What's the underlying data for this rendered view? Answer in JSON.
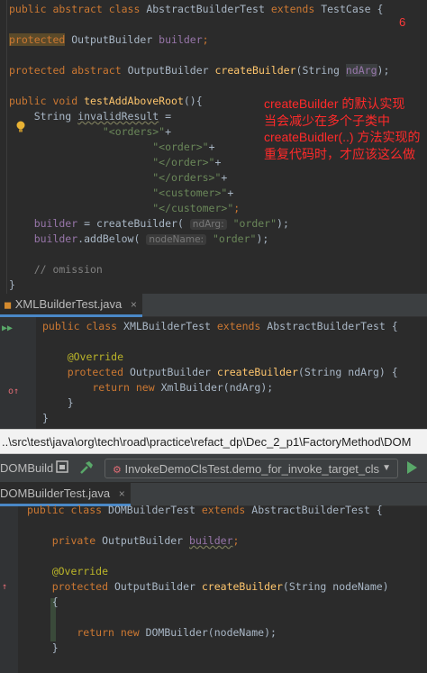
{
  "panel1": {
    "lines": [
      [
        [
          "kw",
          "public abstract class "
        ],
        [
          "cls",
          "AbstractBuilderTest "
        ],
        [
          "kw",
          "extends "
        ],
        [
          "cls",
          "TestCase {"
        ]
      ],
      [],
      [
        [
          "prot",
          "protected"
        ],
        [
          "cls",
          " OutputBuilder "
        ],
        [
          "field",
          "builder"
        ],
        [
          "kw",
          ";"
        ]
      ],
      [],
      [
        [
          "kw",
          "protected abstract "
        ],
        [
          "cls",
          "OutputBuilder "
        ],
        [
          "fn",
          "createBuilder"
        ],
        [
          "cls",
          "(String "
        ],
        [
          "param",
          "ndArg"
        ],
        [
          "cls",
          ");"
        ]
      ],
      [],
      [
        [
          "kw",
          "public void "
        ],
        [
          "fn",
          "testAddAboveRoot"
        ],
        [
          "cls",
          "(){"
        ]
      ],
      [
        [
          "cls",
          "    String "
        ],
        [
          "warn",
          "invalidResult"
        ],
        [
          "cls",
          " ="
        ]
      ],
      [
        [
          "str",
          "               \"<orders>\""
        ],
        [
          "cls",
          "+"
        ]
      ],
      [
        [
          "str",
          "                       \"<order>\""
        ],
        [
          "cls",
          "+"
        ]
      ],
      [
        [
          "str",
          "                       \"</order>\""
        ],
        [
          "cls",
          "+"
        ]
      ],
      [
        [
          "str",
          "                       \"</orders>\""
        ],
        [
          "cls",
          "+"
        ]
      ],
      [
        [
          "str",
          "                       \"<customer>\""
        ],
        [
          "cls",
          "+"
        ]
      ],
      [
        [
          "str",
          "                       \"</customer>\""
        ],
        [
          "kw",
          ";"
        ]
      ],
      [
        [
          "field",
          "    builder"
        ],
        [
          "cls",
          " = createBuilder( "
        ],
        [
          "hint",
          "ndArg:"
        ],
        [
          "str",
          " \"order\""
        ],
        [
          "cls",
          ");"
        ]
      ],
      [
        [
          "field",
          "    builder"
        ],
        [
          "cls",
          ".addBelow( "
        ],
        [
          "hint",
          "nodeName:"
        ],
        [
          "str",
          " \"order\""
        ],
        [
          "cls",
          ");"
        ]
      ],
      [],
      [
        [
          "cmt",
          "    // omission"
        ]
      ],
      [
        [
          "cls",
          "}"
        ]
      ]
    ],
    "annotation_lines": [
      "createBuilder 的默认实现",
      "当会减少在多个子类中",
      "createBuidler(..) 方法实现的",
      "重复代码时，才应该这么做"
    ],
    "marker": "6"
  },
  "panel2": {
    "tab_label": "XMLBuilderTest.java",
    "tab_close": "×",
    "lines": [
      [
        [
          "kw",
          "public class "
        ],
        [
          "cls",
          "XMLBuilderTest "
        ],
        [
          "kw",
          "extends "
        ],
        [
          "cls",
          "AbstractBuilderTest {"
        ]
      ],
      [],
      [
        [
          "ann",
          "    @Override"
        ]
      ],
      [
        [
          "kw",
          "    protected "
        ],
        [
          "cls",
          "OutputBuilder "
        ],
        [
          "fn",
          "createBuilder"
        ],
        [
          "cls",
          "(String ndArg) {"
        ]
      ],
      [
        [
          "kw",
          "        return new "
        ],
        [
          "cls",
          "XmlBuilder(ndArg);"
        ]
      ],
      [
        [
          "cls",
          "    }"
        ]
      ],
      [
        [
          "cls",
          "}"
        ]
      ]
    ]
  },
  "pathbar": {
    "text": "..\\src\\test\\java\\org\\tech\\road\\practice\\refact_dp\\Dec_2_p1\\FactoryMethod\\DOM"
  },
  "toolbar": {
    "label": "DOMBuild",
    "run_config": "InvokeDemoClsTest.demo_for_invoke_target_cls",
    "dropdown_arrow": "▼"
  },
  "panel3": {
    "tab_label": "DOMBuilderTest.java",
    "tab_close": "×",
    "lines": [
      [
        [
          "kw",
          "public class "
        ],
        [
          "cls",
          "DOMBuilderTest "
        ],
        [
          "kw",
          "extends "
        ],
        [
          "cls",
          "AbstractBuilderTest {"
        ]
      ],
      [],
      [
        [
          "kw",
          "    private "
        ],
        [
          "cls",
          "OutputBuilder "
        ],
        [
          "warnf",
          "builder"
        ],
        [
          "kw",
          ";"
        ]
      ],
      [],
      [
        [
          "ann",
          "    @Override"
        ]
      ],
      [
        [
          "kw",
          "    protected "
        ],
        [
          "cls",
          "OutputBuilder "
        ],
        [
          "fn",
          "createBuilder"
        ],
        [
          "cls",
          "(String nodeName)"
        ]
      ],
      [
        [
          "cls",
          "    {"
        ]
      ],
      [],
      [
        [
          "kw",
          "        return new "
        ],
        [
          "cls",
          "DOMBuilder(nodeName);"
        ]
      ],
      [
        [
          "cls",
          "    }"
        ]
      ]
    ]
  },
  "colors": {
    "background": "#2b2b2b",
    "keyword": "#cc7832",
    "string": "#6a8759",
    "method": "#ffc66d",
    "field": "#9876aa",
    "annotation": "#bbb529",
    "red_note": "#ff2a2a"
  }
}
